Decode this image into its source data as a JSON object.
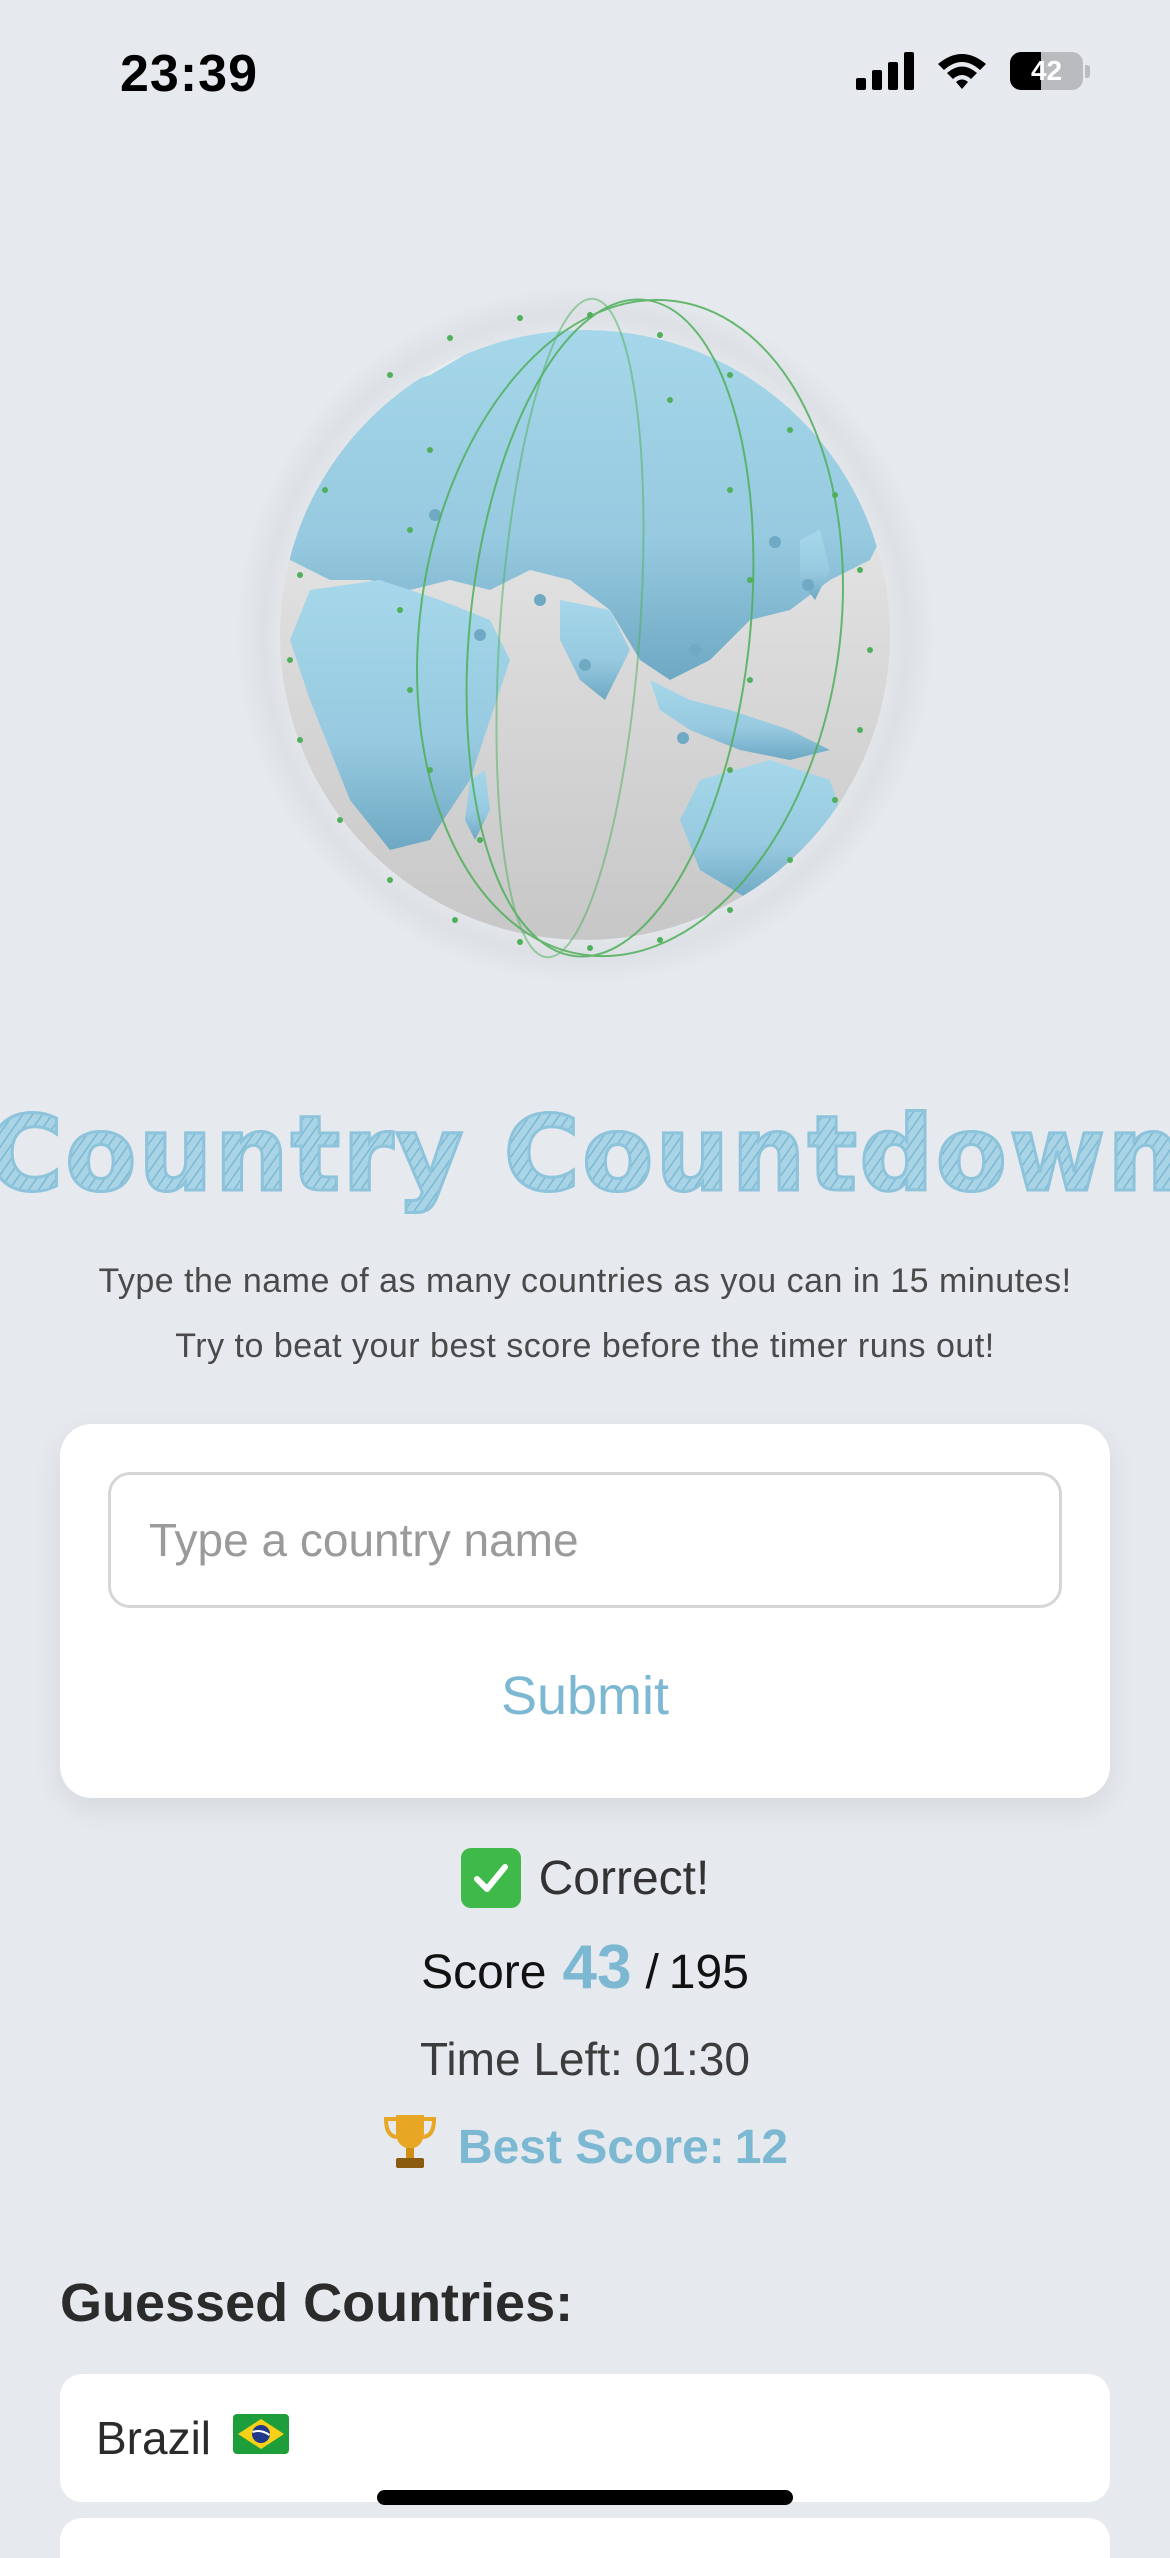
{
  "status_bar": {
    "time": "23:39",
    "battery_level": "42",
    "icons": [
      "cellular-signal-icon",
      "wifi-icon",
      "battery-icon"
    ]
  },
  "hero": {
    "image": "globe-illustration"
  },
  "title": "Country Countdown",
  "subtitle": {
    "line1": "Type the name of as many countries as you can in 15 minutes!",
    "line2": "Try to beat your best score before the timer runs out!"
  },
  "form": {
    "input_placeholder": "Type a country name",
    "input_value": "",
    "submit_label": "Submit"
  },
  "feedback": {
    "icon": "check-mark-icon",
    "text": "Correct!"
  },
  "score": {
    "label": "Score",
    "value": "43",
    "separator": "/",
    "total": "195"
  },
  "timer": {
    "label": "Time Left:",
    "value": "01:30"
  },
  "best": {
    "icon": "trophy-icon",
    "label": "Best Score:",
    "value": "12"
  },
  "guessed": {
    "heading": "Guessed Countries:",
    "items": [
      {
        "name": "Brazil",
        "flag": "brazil-flag-icon"
      }
    ]
  },
  "colors": {
    "background": "#E6EAEE",
    "accent": "#7DB8D3",
    "card": "#FFFFFF",
    "success": "#3FB94A"
  }
}
